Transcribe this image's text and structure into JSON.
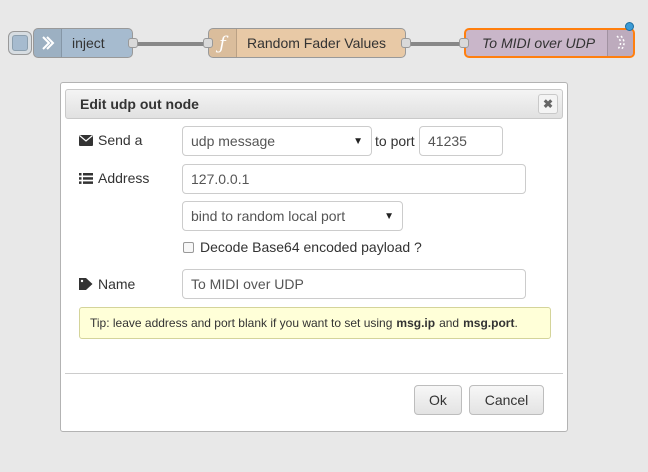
{
  "flow": {
    "inject_label": "inject",
    "function_label": "Random Fader Values",
    "function_icon_glyph": "ƒ",
    "udp_label": "To MIDI over UDP",
    "colors": {
      "inject": "#a6bbcf",
      "function": "#fdd0a2",
      "udp": "#d8bfd8",
      "selected_border": "#ff7f0e",
      "status": "#3b9bd6"
    }
  },
  "dialog": {
    "title": "Edit udp out node",
    "send": {
      "label": "Send a",
      "value": "udp message",
      "to_port_label": "to port",
      "port_value": "41235"
    },
    "address": {
      "label": "Address",
      "value": "127.0.0.1"
    },
    "bind": {
      "value": "bind to random local port"
    },
    "decode": {
      "label": "Decode Base64 encoded payload ?",
      "checked": false
    },
    "name": {
      "label": "Name",
      "value": "To MIDI over UDP"
    },
    "tip": {
      "prefix": "Tip: leave address and port blank if you want to set using",
      "key1": "msg.ip",
      "and": "and",
      "key2": "msg.port",
      "suffix": "."
    },
    "buttons": {
      "ok": "Ok",
      "cancel": "Cancel"
    }
  }
}
